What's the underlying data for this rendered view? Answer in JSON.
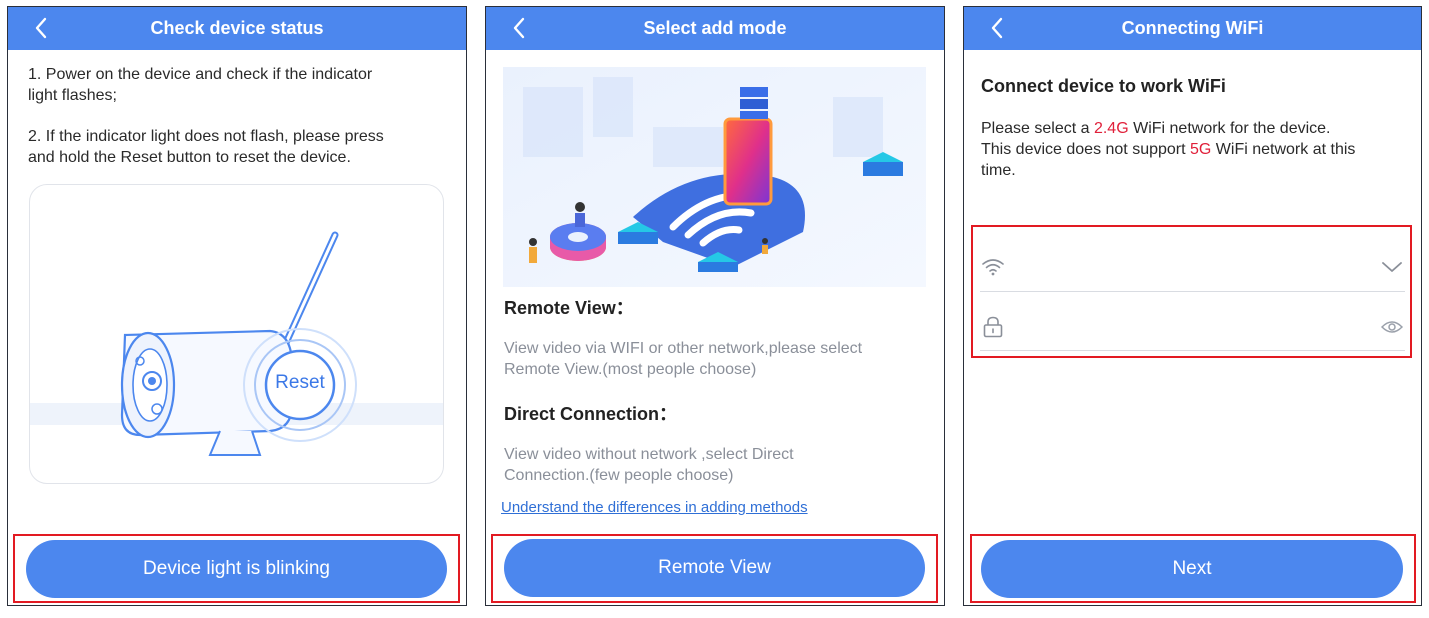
{
  "panel1": {
    "title": "Check device status",
    "step1_line1": "1. Power on the device and check if the indicator",
    "step1_line2": "light flashes;",
    "step2_line1": "2. If the indicator light does not flash, please press",
    "step2_line2": "and hold the Reset button to reset the device.",
    "reset_label": "Reset",
    "button": "Device light is blinking"
  },
  "panel2": {
    "title": "Select add mode",
    "remote_heading": "Remote View：",
    "remote_desc_line1": "View video via WIFI or other network,please select",
    "remote_desc_line2": "Remote View.(most people choose)",
    "direct_heading": "Direct Connection：",
    "direct_desc_line1": "View video without network ,select Direct",
    "direct_desc_line2": "Connection.(few people choose)",
    "link": "Understand the differences in adding methods",
    "button": "Remote View"
  },
  "panel3": {
    "title": "Connecting WiFi",
    "heading": "Connect device to work WiFi",
    "line1_pre": "Please select a ",
    "line1_hl": "2.4G",
    "line1_post": " WiFi network for the device.",
    "line2_pre": "This device does not support ",
    "line2_hl": "5G",
    "line2_post": " WiFi network at this",
    "line3": "time.",
    "ssid_value": "",
    "password_value": "",
    "button": "Next"
  },
  "colors": {
    "header_blue": "#4c87ee",
    "highlight_red": "#e0203a",
    "annotation_red": "#e21a22"
  },
  "icons": [
    "back-arrow-icon",
    "wifi-icon",
    "chevron-down-icon",
    "lock-icon",
    "eye-icon"
  ]
}
